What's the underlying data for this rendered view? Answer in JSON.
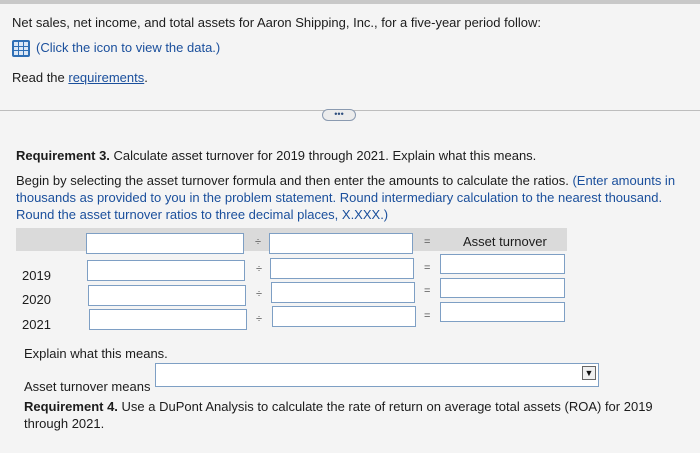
{
  "intro": {
    "line": "Net sales, net income, and total assets for Aaron Shipping, Inc., for a five-year period follow:",
    "data_link": "(Click the icon to view the data.)",
    "read_prefix": "Read the ",
    "requirements_link": "requirements",
    "read_suffix": "."
  },
  "expand_button": "•••",
  "req3": {
    "label": "Requirement 3.",
    "text": " Calculate asset turnover for 2019 through 2021. Explain what this means.",
    "instructions": "Begin by selecting the asset turnover formula and then enter the amounts to calculate the ratios.",
    "instructions_blue": " (Enter amounts in thousands as provided to you in the problem statement. Round intermediary calculation to the nearest thousand. Round the asset turnover ratios to three decimal places, X.XXX.)"
  },
  "table": {
    "result_header": "Asset turnover",
    "divide_symbol": "÷",
    "equals_symbol": "=",
    "rows": [
      {
        "year": "2019",
        "numerator": "",
        "denominator": "",
        "result": ""
      },
      {
        "year": "2020",
        "numerator": "",
        "denominator": "",
        "result": ""
      },
      {
        "year": "2021",
        "numerator": "",
        "denominator": "",
        "result": ""
      }
    ]
  },
  "explain": {
    "prompt": "Explain what this means.",
    "label": "Asset turnover means",
    "selected": "",
    "arrow": "▼"
  },
  "req4": {
    "label": "Requirement 4.",
    "text": " Use a DuPont Analysis to calculate the rate of return on average total assets (ROA) for 2019 through 2021."
  }
}
